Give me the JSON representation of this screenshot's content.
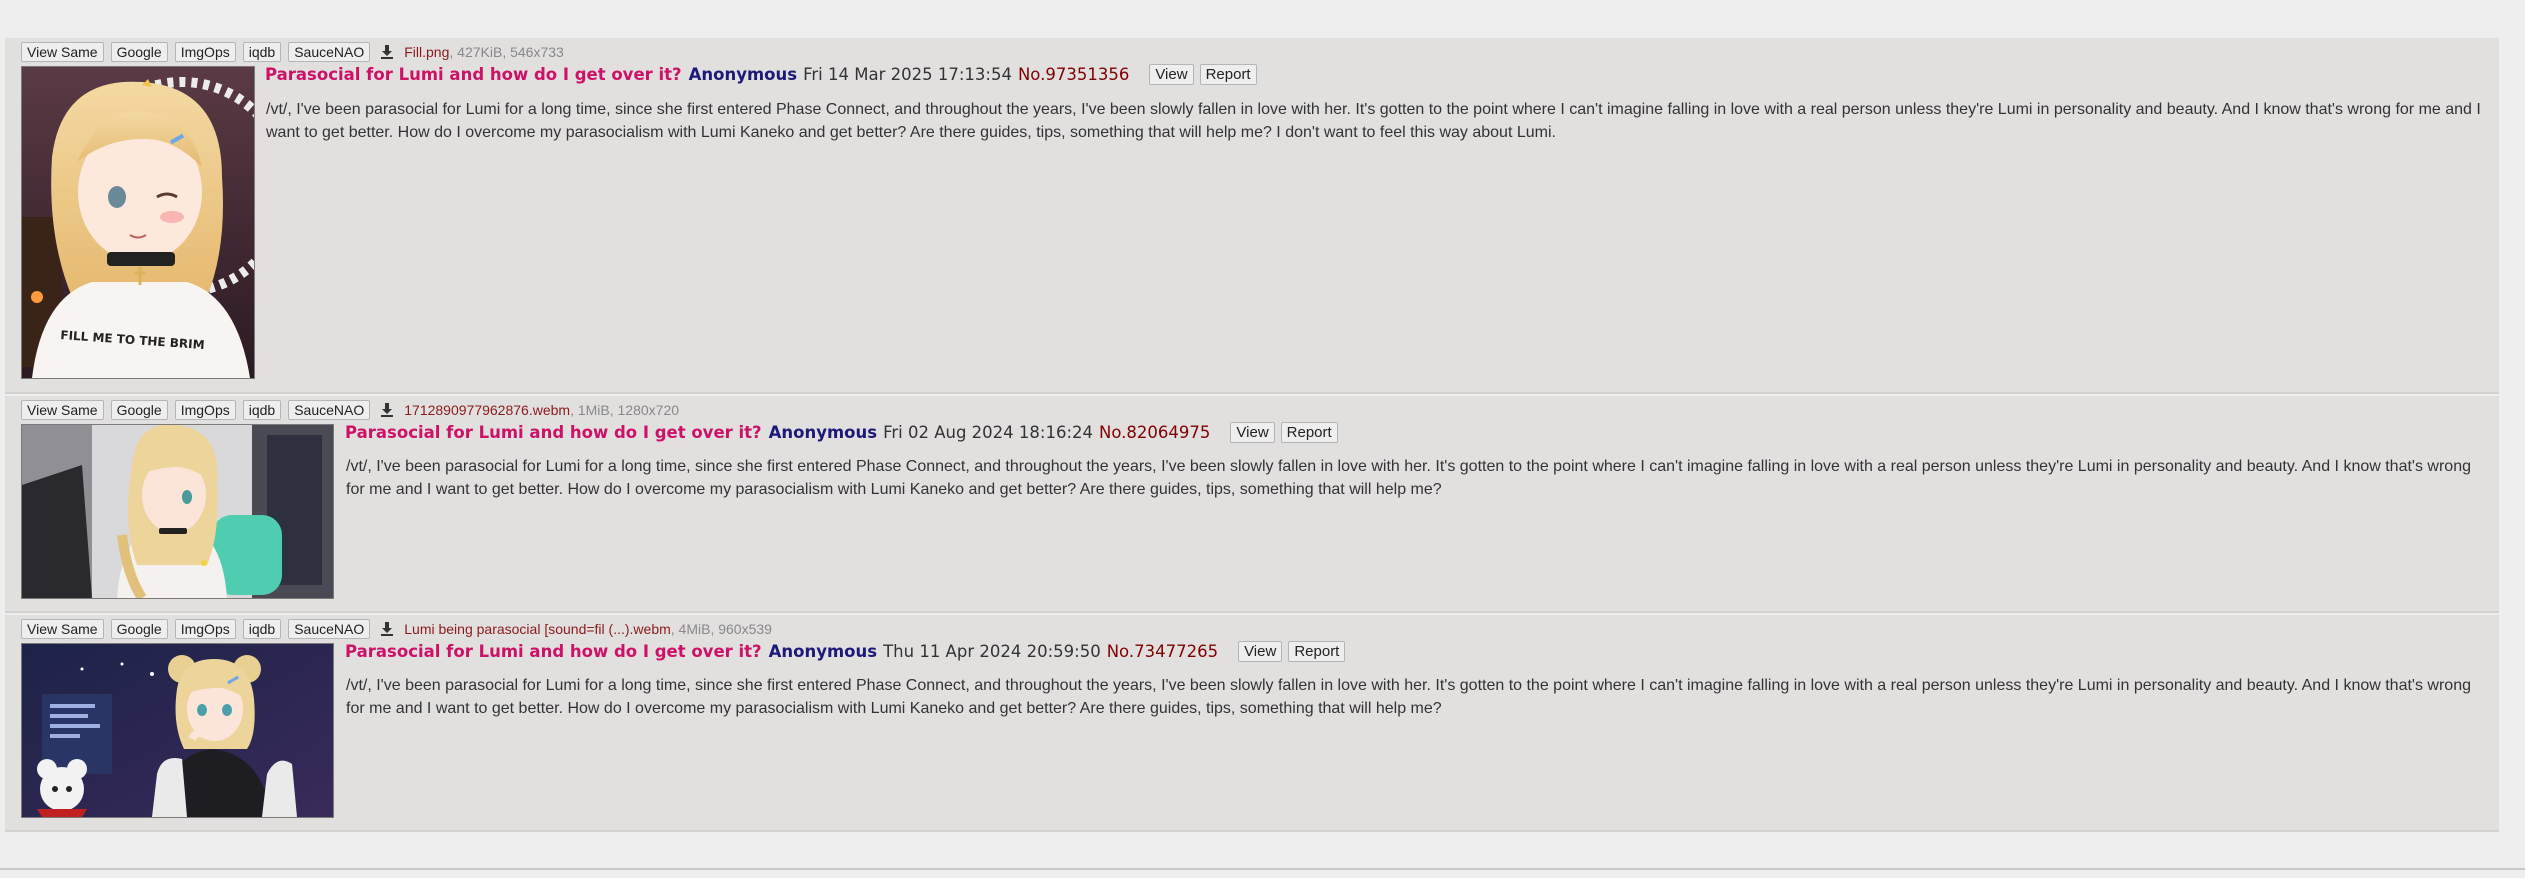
{
  "file_buttons": [
    "View Same",
    "Google",
    "ImgOps",
    "iqdb",
    "SauceNAO"
  ],
  "post_buttons": [
    "View",
    "Report"
  ],
  "posts": [
    {
      "file_name": "Fill.png",
      "file_meta": ", 427KiB, 546x733",
      "subject": "Parasocial for Lumi and how do I get over it?",
      "name": "Anonymous",
      "date": "Fri 14 Mar 2025 17:13:54",
      "post_no": "No.97351356",
      "body": "/vt/, I've been parasocial for Lumi for a long time, since she first entered Phase Connect, and throughout the years, I've been slowly fallen in love with her. It's gotten to the point where I can't imagine falling in love with a real person unless they're Lumi in personality and beauty. And I know that's wrong for me and I want to get better. How do I overcome my parasocialism with Lumi Kaneko and get better? Are there guides, tips, something that will help me? I don't want to feel this way about Lumi.",
      "thumb_text": "FILL ME TO THE BRIM"
    },
    {
      "file_name": "1712890977962876.webm",
      "file_meta": ", 1MiB, 1280x720",
      "subject": "Parasocial for Lumi and how do I get over it?",
      "name": "Anonymous",
      "date": "Fri 02 Aug 2024 18:16:24",
      "post_no": "No.82064975",
      "body": "/vt/, I've been parasocial for Lumi for a long time, since she first entered Phase Connect, and throughout the years, I've been slowly fallen in love with her. It's gotten to the point where I can't imagine falling in love with a real person unless they're Lumi in personality and beauty. And I know that's wrong for me and I want to get better. How do I overcome my parasocialism with Lumi Kaneko and get better? Are there guides, tips, something that will help me?"
    },
    {
      "file_name": "Lumi being parasocial [sound=fil (...).webm",
      "file_meta": ", 4MiB, 960x539",
      "subject": "Parasocial for Lumi and how do I get over it?",
      "name": "Anonymous",
      "date": "Thu 11 Apr 2024 20:59:50",
      "post_no": "No.73477265",
      "body": "/vt/, I've been parasocial for Lumi for a long time, since she first entered Phase Connect, and throughout the years, I've been slowly fallen in love with her. It's gotten to the point where I can't imagine falling in love with a real person unless they're Lumi in personality and beauty. And I know that's wrong for me and I want to get better. How do I overcome my parasocialism with Lumi Kaneko and get better? Are there guides, tips, something that will help me?"
    }
  ],
  "icons": {
    "download": "download-icon"
  },
  "colors": {
    "subject": "#cc1166",
    "name": "#1c1a78",
    "post_no": "#800000",
    "file_name": "#8a1b1b",
    "post_bg": "#e2dfdf",
    "page_bg": "#eeeeee"
  }
}
